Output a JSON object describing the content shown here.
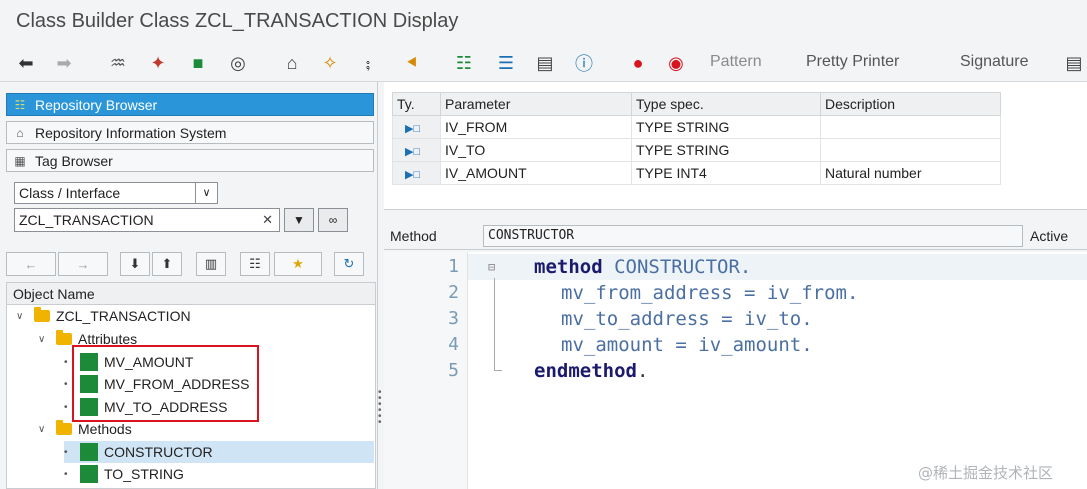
{
  "window": {
    "title": "Class Builder Class ZCL_TRANSACTION Display"
  },
  "toolbar": {
    "pattern_label": "Pattern",
    "pretty_printer_label": "Pretty Printer",
    "signature_label": "Signature"
  },
  "nav": {
    "repository_browser": "Repository Browser",
    "repository_info_system": "Repository Information System",
    "tag_browser": "Tag Browser"
  },
  "object_type": {
    "selected": "Class / Interface"
  },
  "object_name": {
    "value": "ZCL_TRANSACTION"
  },
  "tree": {
    "header": "Object Name",
    "root": "ZCL_TRANSACTION",
    "attributes_label": "Attributes",
    "attributes": [
      "MV_AMOUNT",
      "MV_FROM_ADDRESS",
      "MV_TO_ADDRESS"
    ],
    "methods_label": "Methods",
    "methods": [
      "CONSTRUCTOR",
      "TO_STRING"
    ]
  },
  "params": {
    "columns": [
      "Ty.",
      "Parameter",
      "Type spec.",
      "Description"
    ],
    "rows": [
      {
        "parameter": "IV_FROM",
        "type_spec": "TYPE STRING",
        "description": ""
      },
      {
        "parameter": "IV_TO",
        "type_spec": "TYPE STRING",
        "description": ""
      },
      {
        "parameter": "IV_AMOUNT",
        "type_spec": "TYPE INT4",
        "description": "Natural number"
      }
    ]
  },
  "editor": {
    "method_label": "Method",
    "method_name": "CONSTRUCTOR",
    "status": "Active",
    "line_numbers": [
      "1",
      "2",
      "3",
      "4",
      "5"
    ],
    "lines": {
      "l1_kw": "method",
      "l1_id": " CONSTRUCTOR.",
      "l2": "mv_from_address = iv_from.",
      "l3": "mv_to_address = iv_to.",
      "l4": "mv_amount = iv_amount.",
      "l5_kw": "endmethod",
      "l5_end": "."
    }
  },
  "watermark": "@稀土掘金技术社区"
}
